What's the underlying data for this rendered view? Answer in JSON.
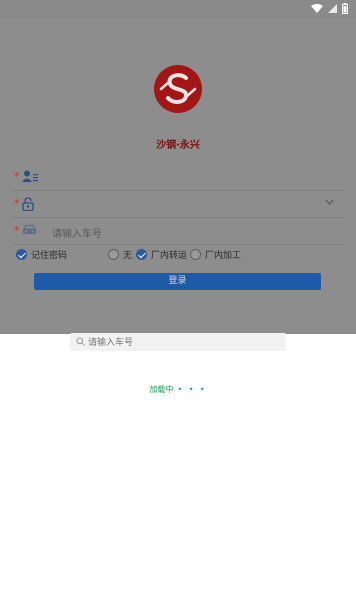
{
  "status_bar": {
    "wifi_icon": "wifi-icon",
    "signal_icon": "signal-icon",
    "battery_icon": "battery-icon"
  },
  "brand": {
    "name": "沙钢·永兴",
    "logo_icon": "company-logo"
  },
  "form": {
    "user_field": {
      "icon": "user-icon",
      "value": ""
    },
    "password_field": {
      "icon": "lock-icon",
      "value": ""
    },
    "vehicle_field": {
      "icon": "car-icon",
      "placeholder": "请输入车号"
    },
    "options": [
      {
        "label": "记住密码",
        "checked": true
      },
      {
        "label": "无",
        "checked": false
      },
      {
        "label": "厂内转运",
        "checked": true
      },
      {
        "label": "厂内加工",
        "checked": false
      }
    ],
    "login_label": "登录"
  },
  "search": {
    "placeholder": "请输入车号"
  },
  "loading": {
    "text": "加载中",
    "dots": "• • •"
  },
  "colors": {
    "accent": "#1f5aa8",
    "loading_text": "#19a35a",
    "brand_red": "#b31b1b",
    "overlay": "#8d8d8d"
  }
}
